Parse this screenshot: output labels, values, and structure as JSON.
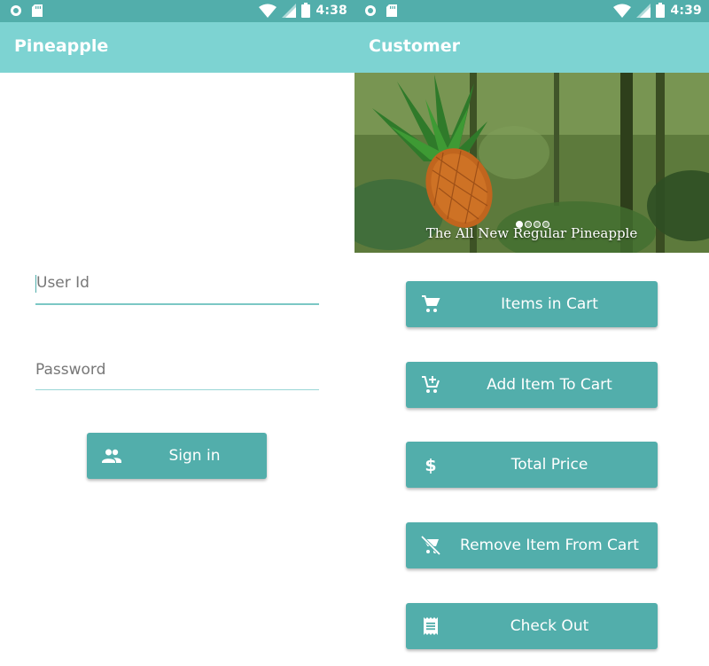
{
  "login": {
    "status": {
      "time": "4:38"
    },
    "appbar_title": "Pineapple",
    "userid_placeholder": "User Id",
    "password_placeholder": "Password",
    "signin_label": "Sign in"
  },
  "customer": {
    "status": {
      "time": "4:39"
    },
    "appbar_title": "Customer",
    "carousel": {
      "caption": "The All New Regular Pineapple",
      "slide_count": 4,
      "active_slide": 1
    },
    "buttons": [
      {
        "label": "Items in Cart",
        "icon": "cart-icon"
      },
      {
        "label": "Add Item To Cart",
        "icon": "add-to-cart-icon"
      },
      {
        "label": "Total Price",
        "icon": "dollar-icon"
      },
      {
        "label": "Remove Item From Cart",
        "icon": "remove-from-cart-icon"
      },
      {
        "label": "Check Out",
        "icon": "receipt-icon"
      }
    ]
  },
  "colors": {
    "statusbar": "#52aeab",
    "appbar": "#7dd3d2",
    "button": "#52aeab"
  }
}
